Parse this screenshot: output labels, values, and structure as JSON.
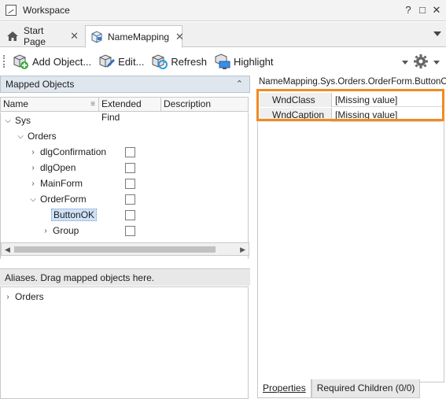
{
  "window": {
    "title": "Workspace",
    "controls": [
      "?",
      "□",
      "✕"
    ]
  },
  "tabs": [
    {
      "label": "Start Page",
      "icon": "home-icon"
    },
    {
      "label": "NameMapping",
      "icon": "namemapping-icon",
      "active": true
    }
  ],
  "toolbar": {
    "add_object": "Add Object...",
    "edit": "Edit...",
    "refresh": "Refresh",
    "highlight": "Highlight"
  },
  "mapped_objects": {
    "header": "Mapped Objects",
    "columns": [
      "Name",
      "Extended Find",
      "Description"
    ],
    "tree": [
      {
        "label": "Sys",
        "level": 0,
        "expanded": true,
        "checkbox": false
      },
      {
        "label": "Orders",
        "level": 1,
        "expanded": true,
        "checkbox": false
      },
      {
        "label": "dlgConfirmation",
        "level": 2,
        "expanded": false,
        "checkbox": true
      },
      {
        "label": "dlgOpen",
        "level": 2,
        "expanded": false,
        "checkbox": true
      },
      {
        "label": "MainForm",
        "level": 2,
        "expanded": false,
        "checkbox": true
      },
      {
        "label": "OrderForm",
        "level": 2,
        "expanded": true,
        "checkbox": true
      },
      {
        "label": "ButtonOK",
        "level": 3,
        "selected": true,
        "checkbox": true
      },
      {
        "label": "Group",
        "level": 3,
        "expanded": false,
        "checkbox": true
      }
    ]
  },
  "aliases": {
    "header": "Aliases. Drag mapped objects here.",
    "items": [
      {
        "label": "Orders"
      }
    ]
  },
  "properties": {
    "path": "NameMapping.Sys.Orders.OrderForm.ButtonOK",
    "rows": [
      {
        "name": "WndClass",
        "value": "[Missing value]"
      },
      {
        "name": "WndCaption",
        "value": "[Missing value]"
      }
    ],
    "tabs": [
      "Properties",
      "Required Children (0/0)"
    ]
  },
  "colors": {
    "highlight_border": "#f08a24",
    "header_bg": "#dfe6ee",
    "selection_bg": "#cfe2f7"
  }
}
